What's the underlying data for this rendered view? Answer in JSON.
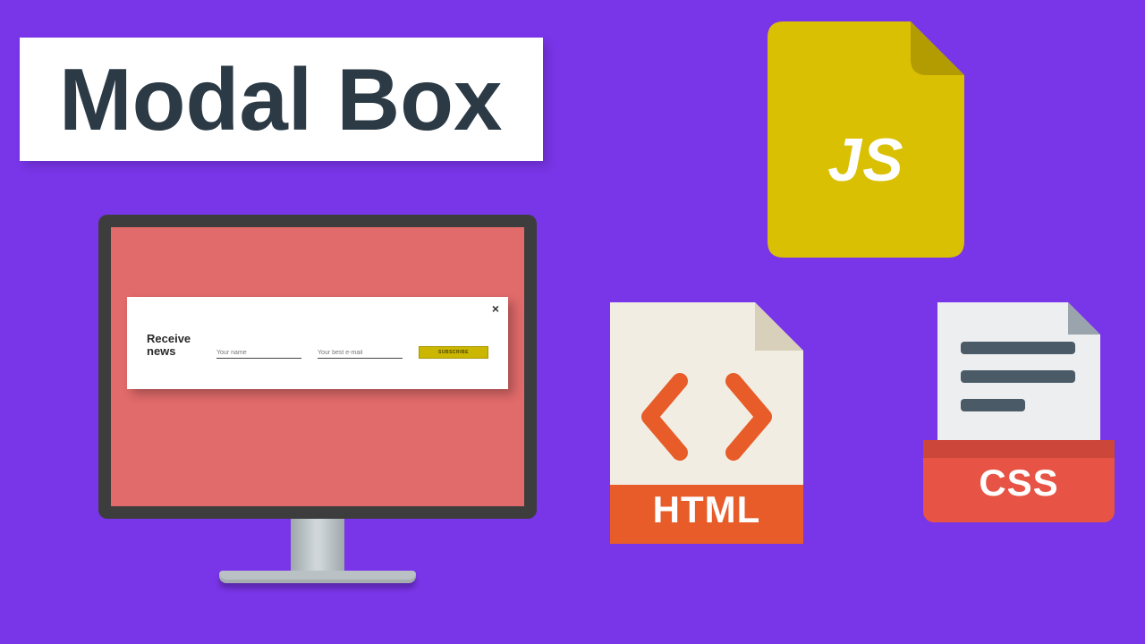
{
  "title": "Modal Box",
  "monitor": {
    "modal": {
      "heading": "Receive news",
      "name_placeholder": "Your name",
      "email_placeholder": "Your best e-mail",
      "button_label": "SUBSCRIBE",
      "close_label": "×"
    }
  },
  "files": {
    "js": {
      "label": "JS"
    },
    "html": {
      "label": "HTML"
    },
    "css": {
      "label": "CSS"
    }
  },
  "colors": {
    "background": "#7935e8",
    "title_text": "#2b3a45",
    "monitor_screen": "#e16a6a",
    "js_file": "#d9c003",
    "html_accent": "#e75c29",
    "css_accent": "#e75345",
    "css_body": "#edeef0"
  }
}
